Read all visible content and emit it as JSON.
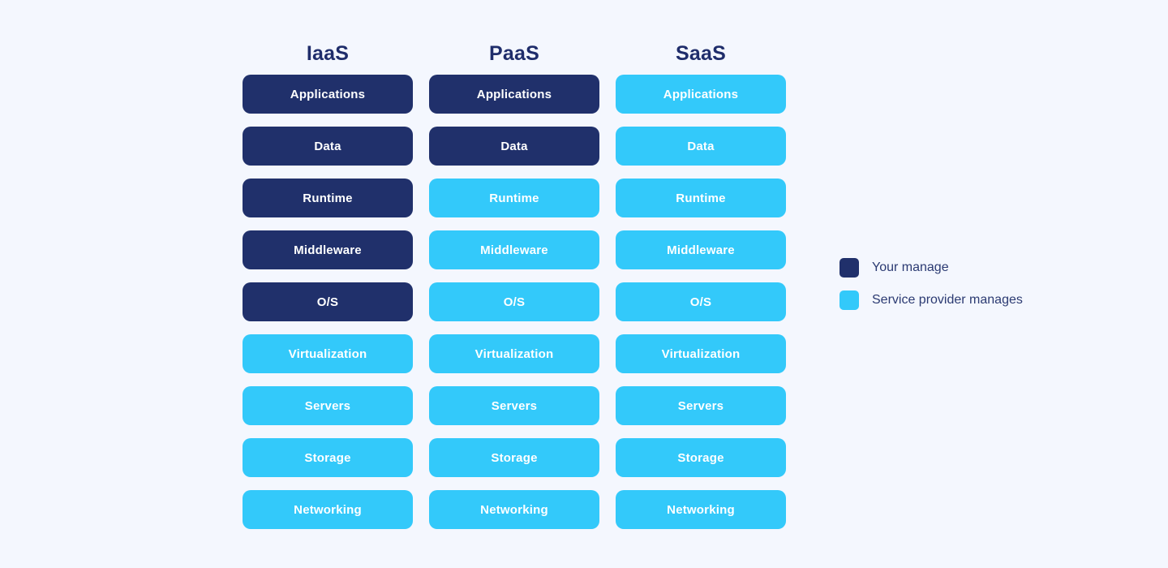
{
  "diagram": {
    "background_color": "#f4f7fe",
    "customer_color": "#20306b",
    "provider_color": "#33c9fa",
    "title_color": "#1f2d6b",
    "layer_names": [
      "Applications",
      "Data",
      "Runtime",
      "Middleware",
      "O/S",
      "Virtualization",
      "Servers",
      "Storage",
      "Networking"
    ],
    "columns": [
      {
        "title": "IaaS",
        "layers": [
          {
            "label": "Applications",
            "managed_by": "customer"
          },
          {
            "label": "Data",
            "managed_by": "customer"
          },
          {
            "label": "Runtime",
            "managed_by": "customer"
          },
          {
            "label": "Middleware",
            "managed_by": "customer"
          },
          {
            "label": "O/S",
            "managed_by": "customer"
          },
          {
            "label": "Virtualization",
            "managed_by": "provider"
          },
          {
            "label": "Servers",
            "managed_by": "provider"
          },
          {
            "label": "Storage",
            "managed_by": "provider"
          },
          {
            "label": "Networking",
            "managed_by": "provider"
          }
        ]
      },
      {
        "title": "PaaS",
        "layers": [
          {
            "label": "Applications",
            "managed_by": "customer"
          },
          {
            "label": "Data",
            "managed_by": "customer"
          },
          {
            "label": "Runtime",
            "managed_by": "provider"
          },
          {
            "label": "Middleware",
            "managed_by": "provider"
          },
          {
            "label": "O/S",
            "managed_by": "provider"
          },
          {
            "label": "Virtualization",
            "managed_by": "provider"
          },
          {
            "label": "Servers",
            "managed_by": "provider"
          },
          {
            "label": "Storage",
            "managed_by": "provider"
          },
          {
            "label": "Networking",
            "managed_by": "provider"
          }
        ]
      },
      {
        "title": "SaaS",
        "layers": [
          {
            "label": "Applications",
            "managed_by": "provider"
          },
          {
            "label": "Data",
            "managed_by": "provider"
          },
          {
            "label": "Runtime",
            "managed_by": "provider"
          },
          {
            "label": "Middleware",
            "managed_by": "provider"
          },
          {
            "label": "O/S",
            "managed_by": "provider"
          },
          {
            "label": "Virtualization",
            "managed_by": "provider"
          },
          {
            "label": "Servers",
            "managed_by": "provider"
          },
          {
            "label": "Storage",
            "managed_by": "provider"
          },
          {
            "label": "Networking",
            "managed_by": "provider"
          }
        ]
      }
    ],
    "legend": {
      "items": [
        {
          "label": "Your manage",
          "managed_by": "customer",
          "color": "#20306b"
        },
        {
          "label": "Service provider manages",
          "managed_by": "provider",
          "color": "#33c9fa"
        }
      ]
    }
  }
}
